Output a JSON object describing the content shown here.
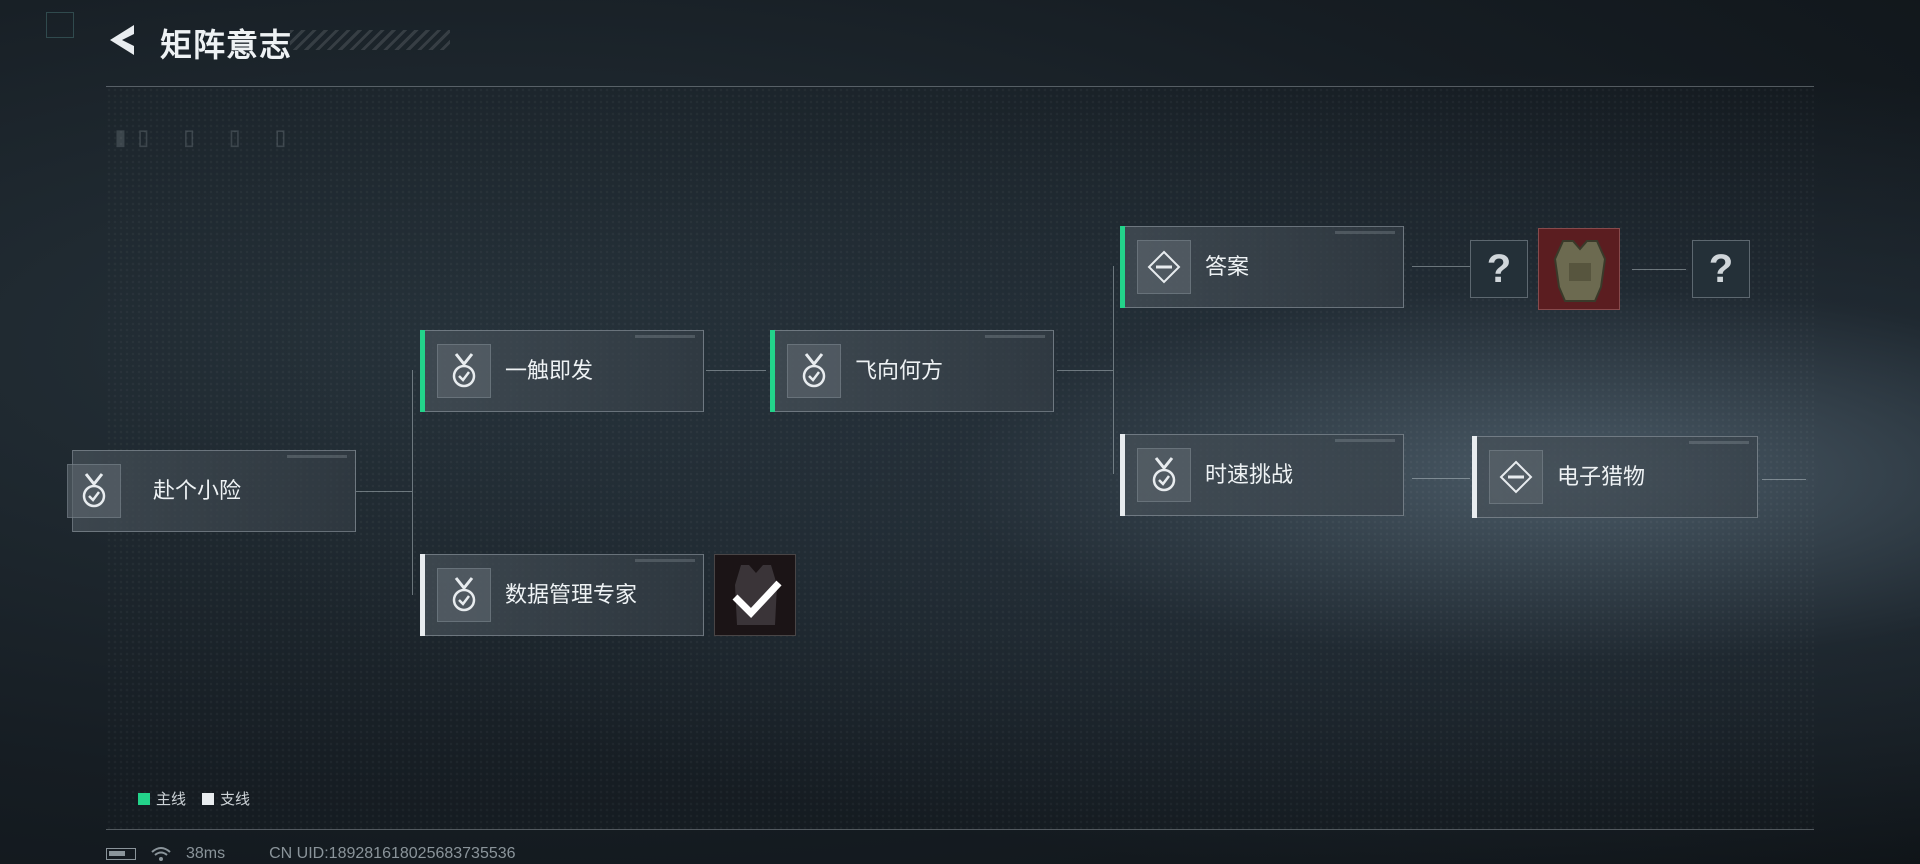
{
  "header": {
    "title": "矩阵意志"
  },
  "quests": {
    "q1": {
      "label": "赴个小险",
      "line": "branch"
    },
    "q2": {
      "label": "一触即发",
      "line": "main"
    },
    "q3": {
      "label": "数据管理专家",
      "line": "branch"
    },
    "q4": {
      "label": "飞向何方",
      "line": "main"
    },
    "q5": {
      "label": "答案",
      "line": "main"
    },
    "q6": {
      "label": "时速挑战",
      "line": "branch"
    },
    "q7": {
      "label": "电子猎物",
      "line": "branch"
    }
  },
  "rewards": {
    "unknown_symbol": "?"
  },
  "legend": {
    "main_label": "主线",
    "branch_label": "支线",
    "main_color": "#23d38a",
    "branch_color": "#e8ecef"
  },
  "status": {
    "ping": "38ms",
    "uid": "CN UID:1892816180256837355​36"
  }
}
